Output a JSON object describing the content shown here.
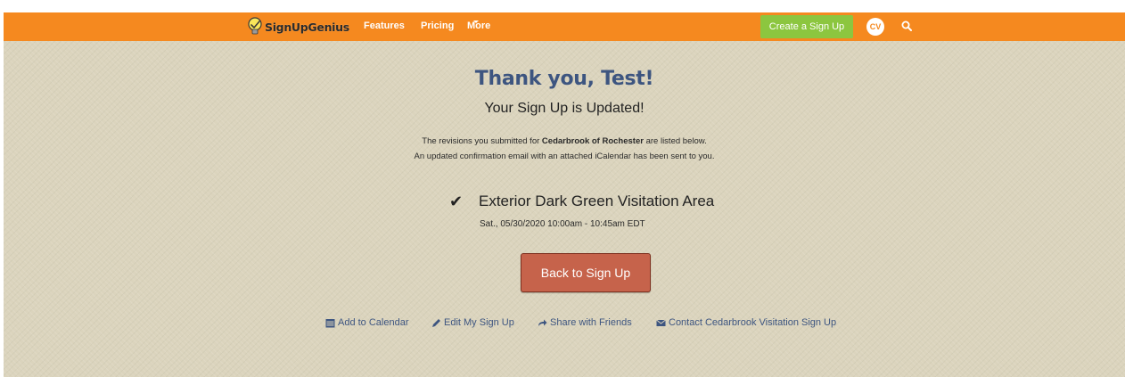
{
  "navbar": {
    "logo_text": "SignUpGenius",
    "links": {
      "features": "Features",
      "pricing": "Pricing",
      "more": "More"
    },
    "create_button": "Create a Sign Up",
    "avatar_initials": "CV",
    "search_icon": "search-icon"
  },
  "main": {
    "title": "Thank you, Test!",
    "subtitle": "Your Sign Up is Updated!",
    "revision_prefix": "The revisions you submitted for ",
    "organization": "Cedarbrook of Rochester",
    "revision_suffix": " are listed below.",
    "email_notice": "An updated confirmation email with an attached iCalendar has been sent to you.",
    "item": {
      "icon": "check-icon",
      "title": "Exterior Dark Green Visitation Area",
      "datetime": "Sat., 05/30/2020 10:00am - 10:45am EDT"
    },
    "back_button": "Back to Sign Up",
    "actions": {
      "add_calendar": "Add to Calendar",
      "edit_signup": "Edit My Sign Up",
      "share": "Share with Friends",
      "contact": "Contact Cedarbrook Visitation Sign Up"
    }
  },
  "colors": {
    "header": "#f5891f",
    "create_button": "#8cc63f",
    "background": "#dbd4bd",
    "title": "#3d5580",
    "back_button": "#c6634b",
    "link": "#3d5580"
  }
}
